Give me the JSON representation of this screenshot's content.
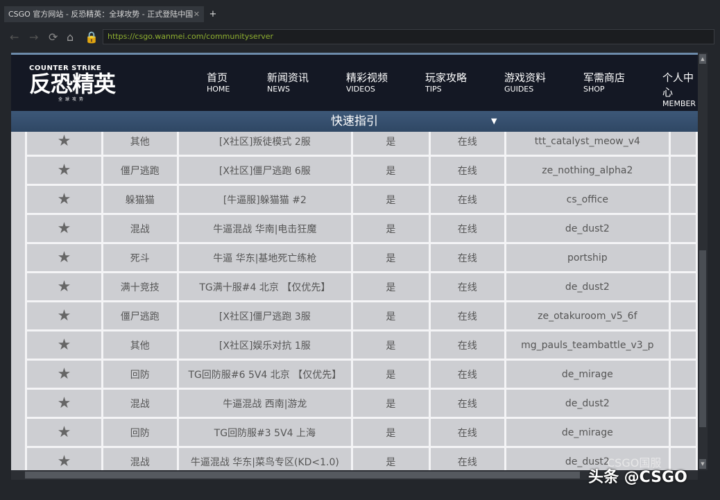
{
  "browser": {
    "tab_title": "CSGO 官方网站 - 反恐精英：全球攻势 - 正式登陆中国",
    "new_tab": "+",
    "url": "https://csgo.wanmei.com/communityserver"
  },
  "header": {
    "logo_en": "COUNTER STRIKE",
    "logo_cn": "反恐精英",
    "logo_sub": "全球攻势",
    "nav": [
      {
        "cn": "首页",
        "en": "HOME"
      },
      {
        "cn": "新闻资讯",
        "en": "NEWS"
      },
      {
        "cn": "精彩视频",
        "en": "VIDEOS"
      },
      {
        "cn": "玩家攻略",
        "en": "TIPS"
      },
      {
        "cn": "游戏资料",
        "en": "GUIDES"
      },
      {
        "cn": "军需商店",
        "en": "SHOP"
      },
      {
        "cn": "个人中心",
        "en": "MEMBER"
      }
    ]
  },
  "guide": {
    "label": "快速指引"
  },
  "rows": [
    {
      "type": "其他",
      "name": "[X社区]叛徒模式 2服",
      "flag": "是",
      "status": "在线",
      "map": "ttt_catalyst_meow_v4"
    },
    {
      "type": "僵尸逃跑",
      "name": "[X社区]僵尸逃跑 6服",
      "flag": "是",
      "status": "在线",
      "map": "ze_nothing_alpha2"
    },
    {
      "type": "躲猫猫",
      "name": "[牛逼服]躲猫猫 #2",
      "flag": "是",
      "status": "在线",
      "map": "cs_office"
    },
    {
      "type": "混战",
      "name": "牛逼混战 华南|电击狂魔",
      "flag": "是",
      "status": "在线",
      "map": "de_dust2"
    },
    {
      "type": "死斗",
      "name": "牛逼 华东|基地死亡练枪",
      "flag": "是",
      "status": "在线",
      "map": "portship"
    },
    {
      "type": "满十竞技",
      "name": "TG满十服#4 北京 【仅优先】",
      "flag": "是",
      "status": "在线",
      "map": "de_dust2"
    },
    {
      "type": "僵尸逃跑",
      "name": "[X社区]僵尸逃跑 3服",
      "flag": "是",
      "status": "在线",
      "map": "ze_otakuroom_v5_6f"
    },
    {
      "type": "其他",
      "name": "[X社区]娱乐对抗 1服",
      "flag": "是",
      "status": "在线",
      "map": "mg_pauls_teambattle_v3_p"
    },
    {
      "type": "回防",
      "name": "TG回防服#6 5V4 北京 【仅优先】",
      "flag": "是",
      "status": "在线",
      "map": "de_mirage"
    },
    {
      "type": "混战",
      "name": "牛逼混战 西南|游龙",
      "flag": "是",
      "status": "在线",
      "map": "de_dust2"
    },
    {
      "type": "回防",
      "name": "TG回防服#3 5V4 上海",
      "flag": "是",
      "status": "在线",
      "map": "de_mirage"
    },
    {
      "type": "混战",
      "name": "牛逼混战 华东|菜鸟专区(KD<1.0)",
      "flag": "是",
      "status": "在线",
      "map": "de_dust2"
    }
  ],
  "watermark": {
    "main": "头条 @CSGO",
    "sub": "CSGO国服"
  }
}
